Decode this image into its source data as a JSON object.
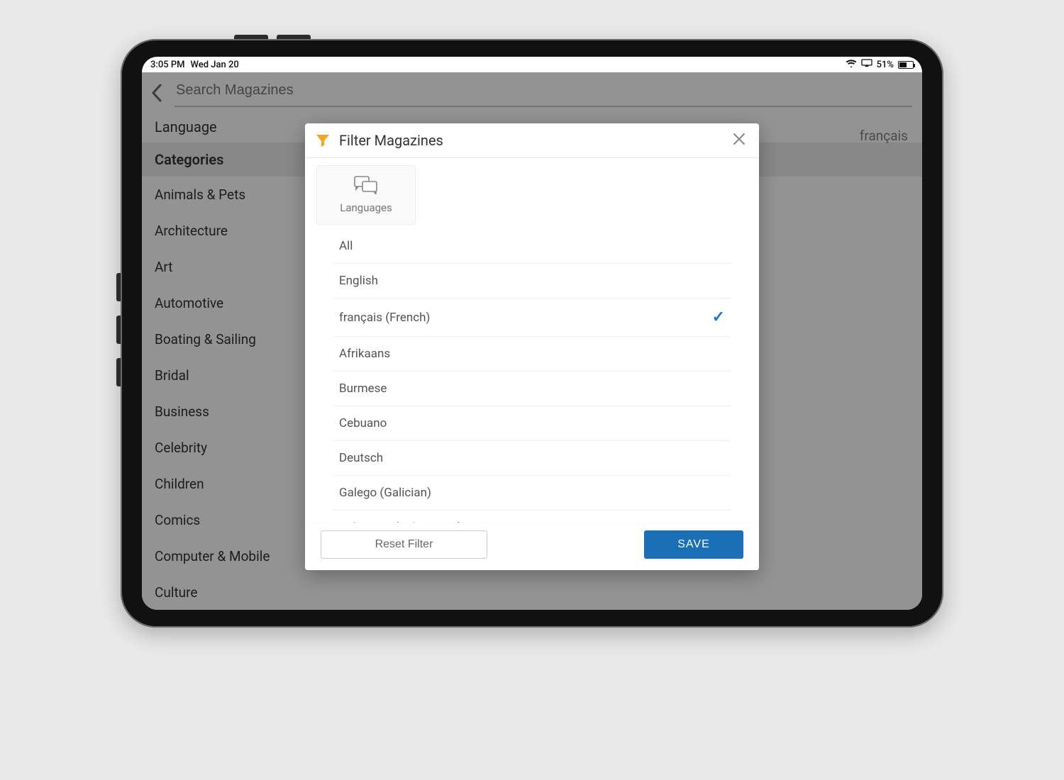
{
  "status": {
    "time": "3:05 PM",
    "date": "Wed Jan 20",
    "battery_pct": "51%"
  },
  "search": {
    "placeholder": "Search Magazines"
  },
  "sidebar": {
    "language_heading": "Language",
    "categories_heading": "Categories",
    "items": [
      "Animals & Pets",
      "Architecture",
      "Art",
      "Automotive",
      "Boating & Sailing",
      "Bridal",
      "Business",
      "Celebrity",
      "Children",
      "Comics",
      "Computer & Mobile",
      "Culture"
    ]
  },
  "selected_language_display": "français",
  "modal": {
    "title": "Filter Magazines",
    "tab_label": "Languages",
    "languages": [
      {
        "label": "All",
        "selected": false
      },
      {
        "label": "English",
        "selected": false
      },
      {
        "label": "français (French)",
        "selected": true
      },
      {
        "label": "Afrikaans",
        "selected": false
      },
      {
        "label": "Burmese",
        "selected": false
      },
      {
        "label": "Cebuano",
        "selected": false
      },
      {
        "label": "Deutsch",
        "selected": false
      },
      {
        "label": "Galego (Galician)",
        "selected": false
      },
      {
        "label": "Indonesia (Indonesian)",
        "selected": false
      }
    ],
    "reset_label": "Reset Filter",
    "save_label": "SAVE"
  }
}
